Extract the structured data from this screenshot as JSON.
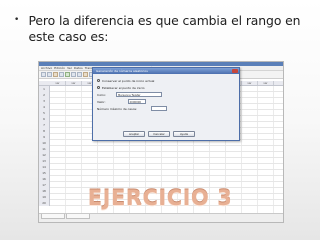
{
  "slide": {
    "bullet_glyph": "•",
    "bullet_text": "Pero la diferencia es que cambia el rango en este caso es:",
    "title": "EJERCICIO 3",
    "title_color": "#e8b094"
  },
  "screenshot": {
    "colors": {
      "titlebar": "#5a7fb8",
      "dialog_border": "#4d6ea8"
    },
    "menu_items": [
      "Archivo",
      "Edición",
      "Ver",
      "Datos",
      "Transformar",
      "Analizar",
      "Marketing directo",
      "Gráficos",
      "Utilidades",
      "Ventana",
      "Ayuda"
    ],
    "column_headers": [
      "var",
      "var",
      "var",
      "var",
      "var",
      "var",
      "var",
      "var",
      "var",
      "var",
      "var",
      "var",
      "var",
      "var"
    ],
    "row_numbers": [
      "1",
      "2",
      "3",
      "4",
      "5",
      "6",
      "7",
      "8",
      "9",
      "10",
      "11",
      "12",
      "13",
      "14",
      "15",
      "16",
      "17",
      "18",
      "19",
      "20"
    ],
    "dialog": {
      "title": "Generación de números aleatorios",
      "option_1": "Conservar el punto de inicio actual",
      "option_2": "Establecer el punto de inicio",
      "field_1_label": "Inicio:",
      "field_1_value": "Mersenne Twister",
      "field_2_label": "Valor:",
      "field_2_value": "2000000",
      "field_3_label": "Número máximo de casos:",
      "field_3_value": "",
      "buttons": [
        "Aceptar",
        "Cancelar",
        "Ayuda"
      ]
    }
  }
}
